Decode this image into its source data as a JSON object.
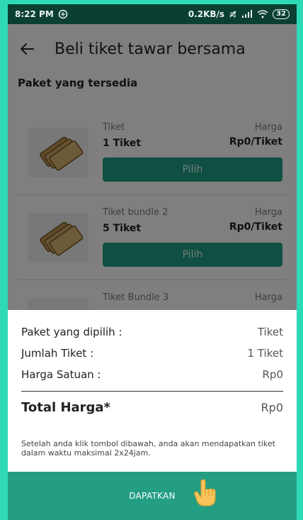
{
  "status_bar": {
    "time": "8:22 PM",
    "network_speed": "0.2KB/s",
    "battery": "32"
  },
  "app_bar": {
    "title": "Beli tiket tawar bersama",
    "back_icon": "arrow-left-icon"
  },
  "section_title": "Paket yang tersedia",
  "packages": [
    {
      "name": "Tiket",
      "count": "1 Tiket",
      "price_label": "Harga",
      "price": "Rp0/Tiket",
      "button": "Pilih"
    },
    {
      "name": "Tiket bundle 2",
      "count": "5 Tiket",
      "price_label": "Harga",
      "price": "Rp0/Tiket",
      "button": "Pilih"
    },
    {
      "name": "Tiket Bundle 3",
      "count": "",
      "price_label": "Harga",
      "price": "",
      "button": ""
    }
  ],
  "summary": {
    "paket_label": "Paket yang dipilih :",
    "paket_value": "Tiket",
    "jumlah_label": "Jumlah Tiket :",
    "jumlah_value": "1 Tiket",
    "harga_label": "Harga Satuan :",
    "harga_value": "Rp0",
    "total_label": "Total Harga*",
    "total_value": "Rp0",
    "note": "Setelah anda klik tombol dibawah, anda akan mendapatkan tiket dalam waktu maksimal 2x24jam."
  },
  "cta": {
    "label": "DAPATKAN",
    "icon": "pointing-hand-icon"
  },
  "colors": {
    "accent": "#239e82",
    "outer_border": "#2fd9b6",
    "status_bar": "#0b3f34"
  }
}
